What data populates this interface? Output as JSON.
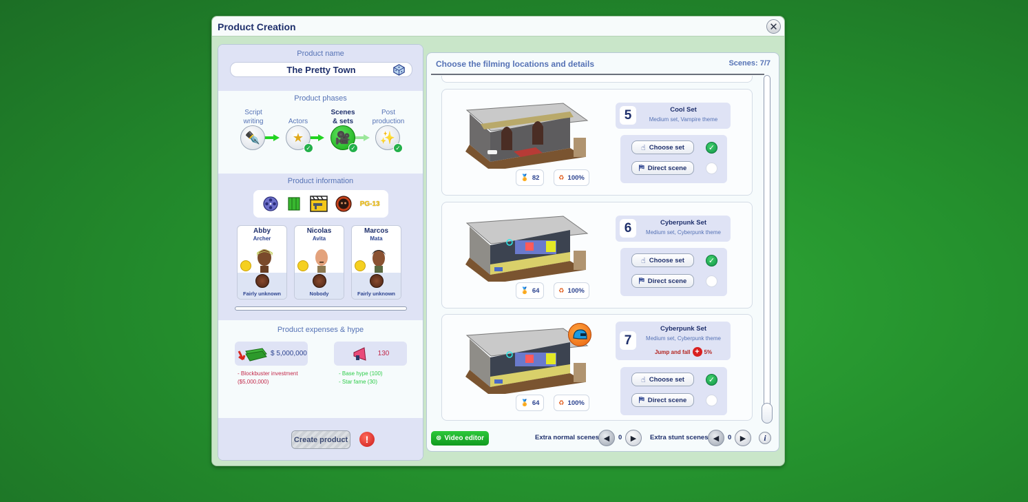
{
  "window": {
    "title": "Product Creation",
    "close_icon": "close-icon"
  },
  "product_name": {
    "label": "Product name",
    "value": "The Pretty Town",
    "randomize_icon": "dice-icon"
  },
  "phases": {
    "label": "Product phases",
    "items": [
      {
        "label_line1": "Script",
        "label_line2": "writing",
        "icon": "pen-icon",
        "completed": false,
        "active": false
      },
      {
        "label_line1": "",
        "label_line2": "Actors",
        "icon": "star-icon",
        "completed": true,
        "active": false
      },
      {
        "label_line1": "Scenes",
        "label_line2": "& sets",
        "icon": "camera-icon",
        "completed": true,
        "active": true
      },
      {
        "label_line1": "Post",
        "label_line2": "production",
        "icon": "magic-wand-icon",
        "completed": true,
        "active": false
      }
    ]
  },
  "product_info": {
    "label": "Product information",
    "icons": [
      "film-reel-icon",
      "money-stack-icon",
      "clapperboard-gun-icon",
      "mask-icon",
      "rating-icon"
    ],
    "rating": "PG-13",
    "actors": [
      {
        "first": "Abby",
        "last": "Archer",
        "fame": "Fairly unknown"
      },
      {
        "first": "Nicolas",
        "last": "Avita",
        "fame": "Nobody"
      },
      {
        "first": "Marcos",
        "last": "Mata",
        "fame": "Fairly unknown"
      }
    ]
  },
  "expenses": {
    "label": "Product expenses & hype",
    "cost": "$ 5,000,000",
    "cost_notes": [
      "- Blockbuster investment",
      "($5,000,000)"
    ],
    "hype": "130",
    "hype_notes": [
      "- Base hype (100)",
      "- Star fame (30)"
    ]
  },
  "create": {
    "label": "Create product",
    "warning_icon": "warning-icon"
  },
  "scenes_panel": {
    "title": "Choose the filming locations and details",
    "count": "Scenes: 7/7",
    "scenes": [
      {
        "number": "5",
        "name": "Cool Set",
        "desc": "Medium set, Vampire theme",
        "stunt": "",
        "stunt_value": "",
        "quality": "82",
        "condition": "100%",
        "set_chosen": true,
        "scene_directed": false
      },
      {
        "number": "6",
        "name": "Cyberpunk Set",
        "desc": "Medium set, Cyberpunk theme",
        "stunt": "",
        "stunt_value": "",
        "quality": "64",
        "condition": "100%",
        "set_chosen": true,
        "scene_directed": false
      },
      {
        "number": "7",
        "name": "Cyberpunk Set",
        "desc": "Medium set, Cyberpunk theme",
        "stunt": "Jump and fall",
        "stunt_value": "5%",
        "quality": "64",
        "condition": "100%",
        "set_chosen": true,
        "scene_directed": false
      }
    ],
    "choose_set_label": "Choose set",
    "direct_scene_label": "Direct scene",
    "scroll_position_fraction": 1.0
  },
  "footer": {
    "video_editor_label": "Video editor",
    "extra_normal_label": "Extra normal scenes:",
    "extra_normal_value": "0",
    "extra_stunt_label": "Extra stunt scenes:",
    "extra_stunt_value": "0",
    "info_label": "i"
  },
  "colors": {
    "background": "#24902d",
    "heading_blue": "#1e2f6b",
    "label_blue": "#5572b5",
    "panel_lavender": "#dfe3f5",
    "success_green": "#23b04b",
    "cost_red": "#c2294a",
    "hype_green": "#2ecc4a"
  }
}
